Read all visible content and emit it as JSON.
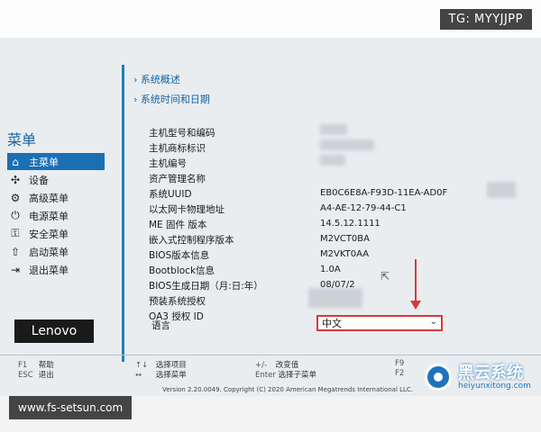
{
  "overlay": {
    "tg_badge": "TG: MYYJJPP",
    "site_badge": "www.fs-setsun.com",
    "brand_cn": "黑云系统",
    "brand_en": "heiyunxitong.com"
  },
  "sidebar": {
    "title": "菜单",
    "items": [
      {
        "label": "主菜单",
        "icon": "home-icon"
      },
      {
        "label": "设备",
        "icon": "devices-icon"
      },
      {
        "label": "高级菜单",
        "icon": "gear-icon"
      },
      {
        "label": "电源菜单",
        "icon": "power-icon"
      },
      {
        "label": "安全菜单",
        "icon": "lock-icon"
      },
      {
        "label": "启动菜单",
        "icon": "boot-icon"
      },
      {
        "label": "退出菜单",
        "icon": "exit-icon"
      }
    ],
    "logo": "Lenovo"
  },
  "main": {
    "links": [
      "系统概述",
      "系统时间和日期"
    ],
    "rows": [
      {
        "label": "主机型号和编码",
        "value": ""
      },
      {
        "label": "主机商标标识",
        "value": ""
      },
      {
        "label": "主机编号",
        "value": ""
      },
      {
        "label": "资产管理名称",
        "value": ""
      },
      {
        "label": "系统UUID",
        "value": "EB0C6E8A-F93D-11EA-AD0F"
      },
      {
        "label": "以太网卡物理地址",
        "value": "A4-AE-12-79-44-C1"
      },
      {
        "label": "ME 固件 版本",
        "value": "14.5.12.1111"
      },
      {
        "label": "嵌入式控制程序版本",
        "value": "M2VCT0BA"
      },
      {
        "label": "BIOS版本信息",
        "value": "M2VKT0AA"
      },
      {
        "label": "Bootblock信息",
        "value": "1.0A"
      },
      {
        "label": "BIOS生成日期（月:日:年）",
        "value": "08/07/2"
      },
      {
        "label": "预装系统授权",
        "value": ""
      },
      {
        "label": "OA3 授权 ID",
        "value": ""
      }
    ],
    "language": {
      "label": "语言",
      "value": "中文"
    }
  },
  "footer": {
    "help": [
      {
        "key": "F1",
        "text": "帮助"
      },
      {
        "key": "ESC",
        "text": "退出"
      },
      {
        "key": "↑↓",
        "text": "选择项目"
      },
      {
        "key": "↔",
        "text": "选择菜单"
      },
      {
        "key": "+/-",
        "text": "改变值"
      },
      {
        "key": "Enter",
        "text": "选择子菜单"
      },
      {
        "key": "F9",
        "text": ""
      },
      {
        "key": "F2",
        "text": ""
      }
    ],
    "version": "Version 2.20.0049. Copyright (C) 2020 American Megatrends International LLC."
  }
}
